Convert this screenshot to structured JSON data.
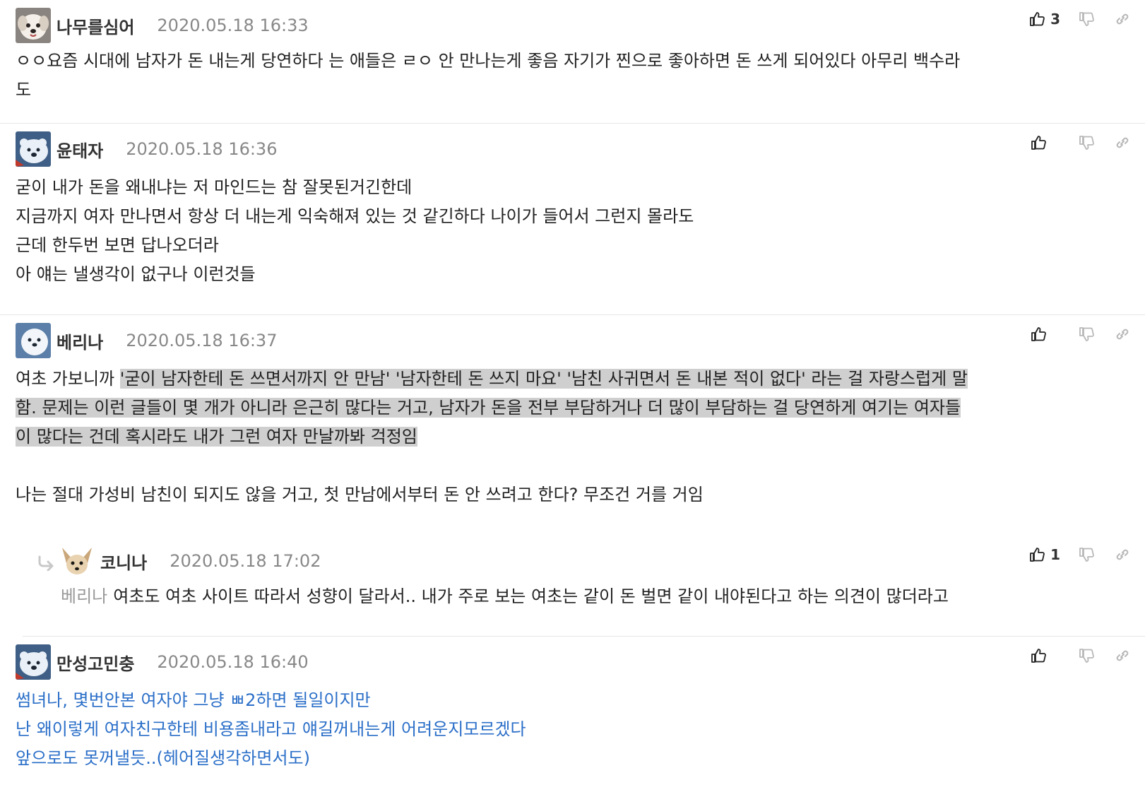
{
  "colors": {
    "accent_blue": "#2b6fc8",
    "highlight_gray": "#cfcfcf",
    "meta_gray": "#888888"
  },
  "icons": {
    "like": "thumbs-up-icon",
    "dislike": "thumbs-down-icon",
    "link": "link-icon",
    "reply": "reply-arrow-icon"
  },
  "comments": [
    {
      "author": "나무를심어",
      "date": "2020.05.18 16:33",
      "likes": "3",
      "lines": [
        "ㅇㅇ요즘 시대에 남자가 돈 내는게 당연하다 는 애들은 ㄹㅇ 안 만나는게 좋음 자기가 찐으로 좋아하면 돈 쓰게 되어있다 아무리 백수라",
        "도"
      ]
    },
    {
      "author": "윤태자",
      "date": "2020.05.18 16:36",
      "likes": "",
      "lines": [
        "굳이 내가 돈을 왜내냐는 저 마인드는 참 잘못된거긴한데",
        "지금까지 여자 만나면서 항상 더 내는게 익숙해져 있는 것 같긴하다 나이가 들어서 그런지 몰라도",
        "근데 한두번 보면 답나오더라",
        "아 얘는 낼생각이 없구나 이런것들"
      ]
    },
    {
      "author": "베리나",
      "date": "2020.05.18 16:37",
      "likes": "",
      "line1_plain": "여초 가보니까 ",
      "line1_hl": "'굳이 남자한테 돈 쓰면서까지 안 만남' '남자한테 돈 쓰지 마요' '남친 사귀면서 돈 내본 적이 없다' 라는 걸 자랑스럽게 말",
      "line2_hl": "함. 문제는 이런 글들이 몇 개가 아니라 은근히 많다는 거고, 남자가 돈을 전부 부담하거나 더 많이 부담하는 걸 당연하게 여기는 여자들",
      "line3_hl": "이 많다는 건데 혹시라도 내가 그런 여자 만날까봐 걱정임",
      "line5": "나는 절대 가성비 남친이 되지도 않을 거고, 첫 만남에서부터 돈 안 쓰려고 한다? 무조건 거를 거임"
    },
    {
      "author": "코니나",
      "date": "2020.05.18 17:02",
      "likes": "1",
      "mention": "베리나",
      "text": "여초도 여초 사이트 따라서 성향이 달라서.. 내가 주로 보는 여초는 같이 돈 벌면 같이 내야된다고 하는 의견이 많더라고"
    },
    {
      "author": "만성고민충",
      "date": "2020.05.18 16:40",
      "likes": "",
      "lines": [
        "썸녀나, 몇번안본 여자야 그냥 ㅃ2하면 될일이지만",
        "난 왜이렇게 여자친구한테 비용좀내라고 얘길꺼내는게 어려운지모르겠다",
        "앞으로도 못꺼낼듯..(헤어질생각하면서도)"
      ]
    }
  ]
}
